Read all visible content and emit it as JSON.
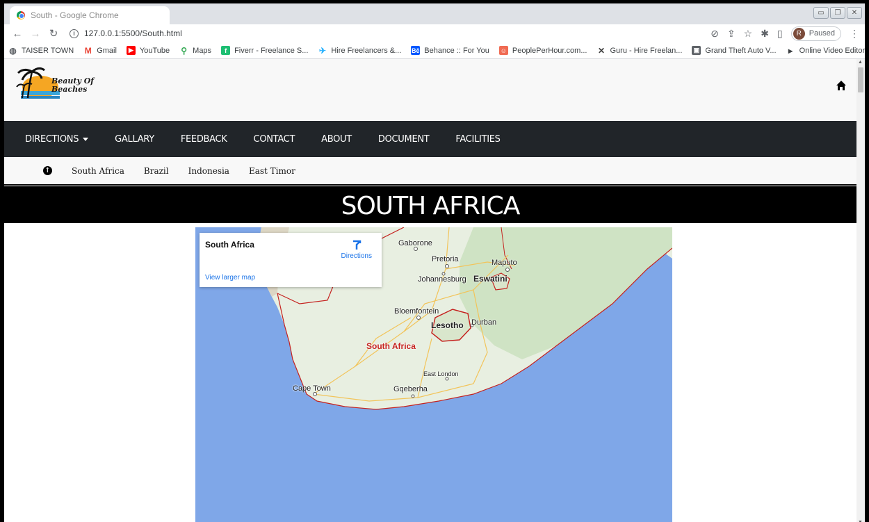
{
  "browser": {
    "tab_title": "South - Google Chrome",
    "url": "127.0.0.1:5500/South.html",
    "profile_initial": "R",
    "profile_status": "Paused",
    "bookmarks": [
      {
        "label": "TAISER TOWN",
        "icon": "globe-icon",
        "color": "#5f6368"
      },
      {
        "label": "Gmail",
        "icon": "gmail-icon",
        "color": "#ea4335"
      },
      {
        "label": "YouTube",
        "icon": "youtube-icon",
        "color": "#ff0000"
      },
      {
        "label": "Maps",
        "icon": "maps-icon",
        "color": "#34a853"
      },
      {
        "label": "Fiverr - Freelance S...",
        "icon": "fiverr-icon",
        "color": "#1dbf73"
      },
      {
        "label": "Hire Freelancers &...",
        "icon": "freelancer-icon",
        "color": "#29b2fe"
      },
      {
        "label": "Behance :: For You",
        "icon": "behance-icon",
        "color": "#0057ff"
      },
      {
        "label": "PeoplePerHour.com...",
        "icon": "pph-icon",
        "color": "#f06b53"
      },
      {
        "label": "Guru - Hire Freelan...",
        "icon": "guru-icon",
        "color": "#3d3d3d"
      },
      {
        "label": "Grand Theft Auto V...",
        "icon": "gta-icon",
        "color": "#5f6368"
      },
      {
        "label": "Online Video Editor...",
        "icon": "video-editor-icon",
        "color": "#3c4043"
      }
    ],
    "bookmarks_more": "»"
  },
  "site": {
    "logo_line1": "Beauty Of",
    "logo_line2": "Beaches",
    "nav": [
      {
        "label": "DIRECTIONS",
        "dropdown": true
      },
      {
        "label": "GALLARY"
      },
      {
        "label": "FEEDBACK"
      },
      {
        "label": "CONTACT"
      },
      {
        "label": "ABOUT"
      },
      {
        "label": "DOCUMENT"
      },
      {
        "label": "FACILITIES"
      }
    ],
    "subnav": [
      "South Africa",
      "Brazil",
      "Indonesia",
      "East Timor"
    ],
    "banner_title": "SOUTH AFRICA"
  },
  "map": {
    "card_title": "South Africa",
    "card_directions": "Directions",
    "card_larger_map": "View larger map",
    "labels": {
      "gaborone": "Gaborone",
      "pretoria": "Pretoria",
      "maputo": "Maputo",
      "johannesburg": "Johannesburg",
      "eswatini": "Eswatini",
      "bloemfontein": "Bloemfontein",
      "lesotho": "Lesotho",
      "durban": "Durban",
      "south_africa": "South Africa",
      "east_london": "East London",
      "cape_town": "Cape Town",
      "gqeberha": "Gqeberha"
    },
    "colors": {
      "ocean": "#7fa7e8",
      "land": "#e8efe1",
      "border": "#c5221f"
    }
  }
}
